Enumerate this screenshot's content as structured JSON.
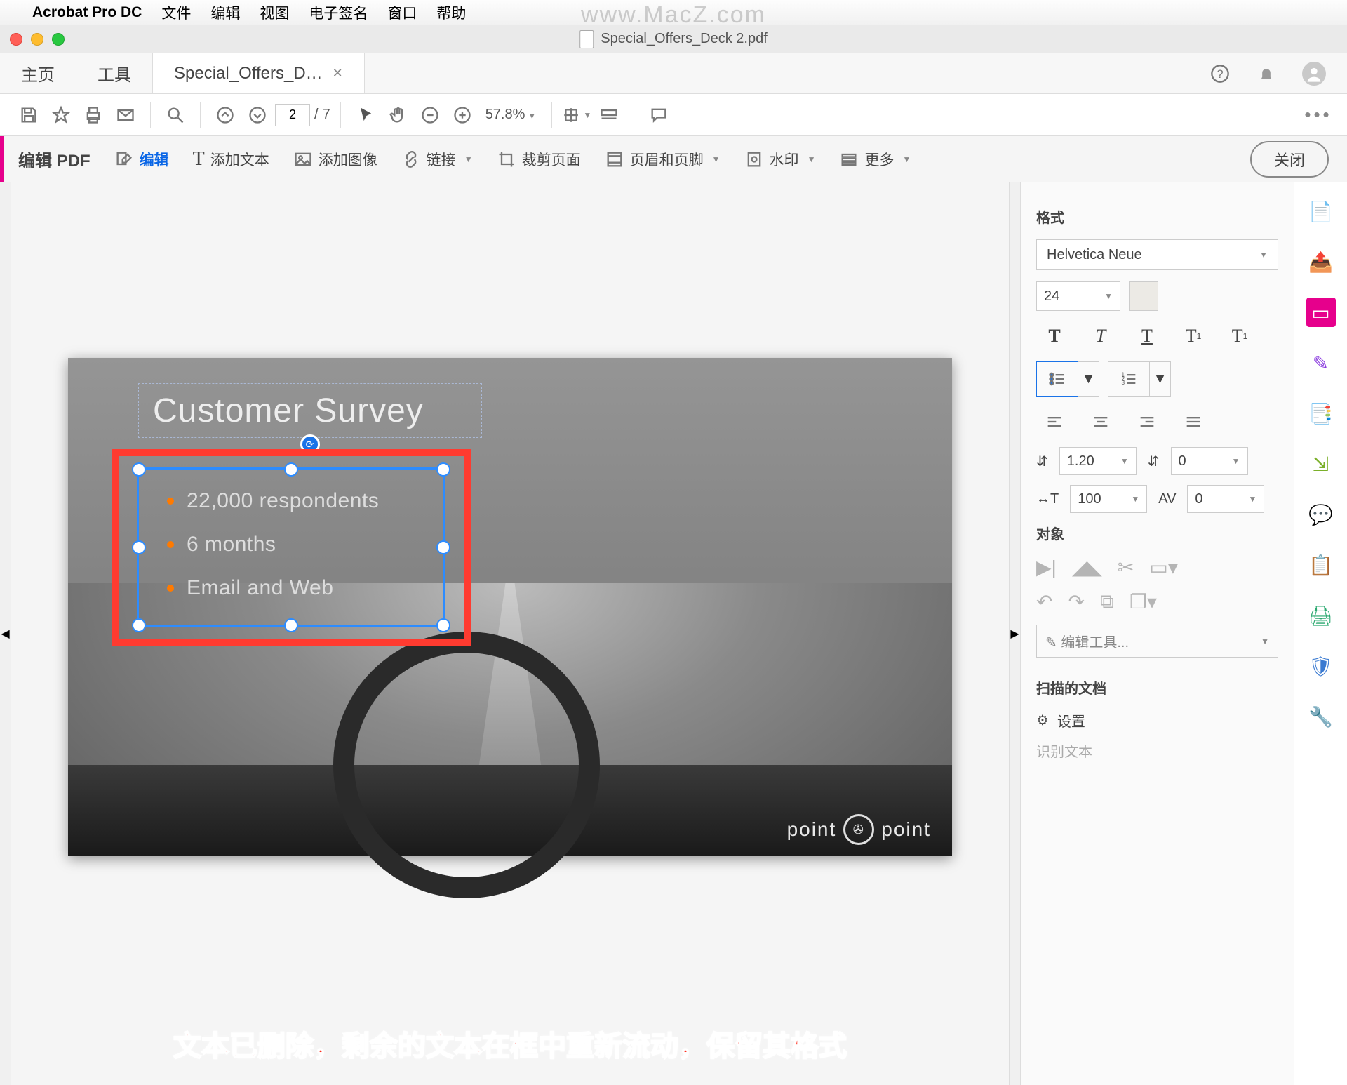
{
  "menubar": {
    "app": "Acrobat Pro DC",
    "items": [
      "文件",
      "编辑",
      "视图",
      "电子签名",
      "窗口",
      "帮助"
    ]
  },
  "watermark": "www.MacZ.com",
  "window": {
    "title": "Special_Offers_Deck 2.pdf"
  },
  "tabs": {
    "home": "主页",
    "tools": "工具",
    "doc": "Special_Offers_D…"
  },
  "toolbar": {
    "page_current": "2",
    "page_total": "7",
    "zoom": "57.8%"
  },
  "editbar": {
    "title": "编辑 PDF",
    "edit": "编辑",
    "addtext": "添加文本",
    "addimage": "添加图像",
    "link": "链接",
    "crop": "裁剪页面",
    "header": "页眉和页脚",
    "watermark": "水印",
    "more": "更多",
    "close": "关闭"
  },
  "slide": {
    "title": "Customer Survey",
    "bullets": [
      "22,000 respondents",
      "6 months",
      "Email and Web"
    ],
    "brand_left": "point",
    "brand_right": "point"
  },
  "annotation": "文本已删除，剩余的文本在框中重新流动，保留其格式",
  "format": {
    "section": "格式",
    "font": "Helvetica Neue",
    "size": "24",
    "line": "1.20",
    "para": "0",
    "hscale": "100",
    "track": "0",
    "object": "对象",
    "edittool": "编辑工具...",
    "scanned": "扫描的文档",
    "settings": "设置",
    "recognize": "识别文本"
  }
}
